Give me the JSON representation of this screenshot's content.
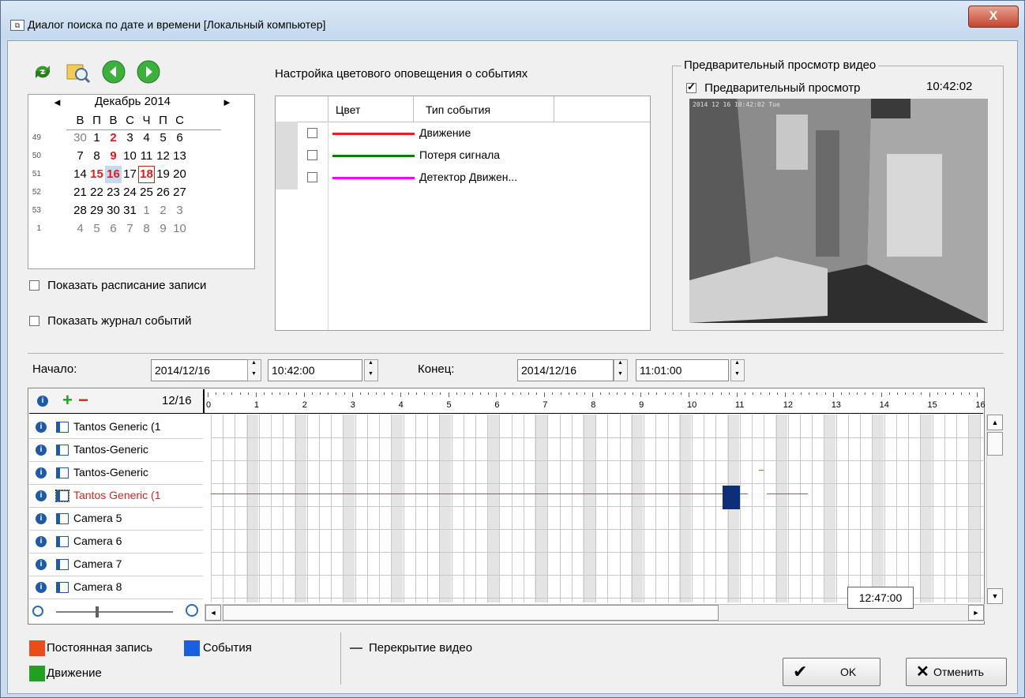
{
  "window": {
    "title": "Диалог поиска по дате и времени [Локальный компьютер]",
    "close_label": "X"
  },
  "toolbar": {
    "icons": [
      "refresh-icon",
      "search-folder-icon",
      "prev-arrow-icon",
      "next-arrow-icon"
    ]
  },
  "calendar": {
    "month_label": "Декабрь 2014",
    "prev_label": "◄",
    "next_label": "►",
    "weekdays": [
      "В",
      "П",
      "В",
      "С",
      "Ч",
      "П",
      "С"
    ],
    "weeks": [
      {
        "num": "49",
        "days": [
          "30",
          "1",
          "2",
          "3",
          "4",
          "5",
          "6"
        ]
      },
      {
        "num": "50",
        "days": [
          "7",
          "8",
          "9",
          "10",
          "11",
          "12",
          "13"
        ]
      },
      {
        "num": "51",
        "days": [
          "14",
          "15",
          "16",
          "17",
          "18",
          "19",
          "20"
        ]
      },
      {
        "num": "52",
        "days": [
          "21",
          "22",
          "23",
          "24",
          "25",
          "26",
          "27"
        ]
      },
      {
        "num": "53",
        "days": [
          "28",
          "29",
          "30",
          "31",
          "1",
          "2",
          "3"
        ]
      },
      {
        "num": "1",
        "days": [
          "4",
          "5",
          "6",
          "7",
          "8",
          "9",
          "10"
        ]
      }
    ],
    "bold_red_days": [
      "2",
      "9",
      "15",
      "16",
      "18"
    ],
    "selected_day": "16",
    "today_day": "18"
  },
  "options": {
    "show_schedule": "Показать расписание записи",
    "show_log": "Показать журнал событий"
  },
  "color_events": {
    "heading": "Настройка цветового оповещения о событиях",
    "col_color": "Цвет",
    "col_type": "Тип события",
    "rows": [
      {
        "color": "#ee1c1c",
        "type": "Движение"
      },
      {
        "color": "#107c10",
        "type": "Потеря сигнала"
      },
      {
        "color": "#ff00ff",
        "type": "Детектор Движен..."
      }
    ]
  },
  "preview": {
    "group_label": "Предварительный просмотр видео",
    "checkbox_label": "Предварительный просмотр",
    "time": "10:42:02"
  },
  "range": {
    "start_label": "Начало:",
    "start_date": "2014/12/16",
    "start_time": "10:42:00",
    "end_label": "Конец:",
    "end_date": "2014/12/16",
    "end_time": "11:01:00"
  },
  "timeline": {
    "date_label": "12/16",
    "hours": [
      "0",
      "1",
      "2",
      "3",
      "4",
      "5",
      "6",
      "7",
      "8",
      "9",
      "10",
      "11",
      "12",
      "13",
      "14",
      "15",
      "16"
    ],
    "cameras": [
      {
        "name": "Tantos Generic (1",
        "active": false
      },
      {
        "name": "Tantos-Generic",
        "active": false
      },
      {
        "name": "Tantos-Generic",
        "active": false
      },
      {
        "name": "Tantos Generic (1",
        "active": true
      },
      {
        "name": "Camera 5",
        "active": false
      },
      {
        "name": "Camera 6",
        "active": false
      },
      {
        "name": "Camera 7",
        "active": false
      },
      {
        "name": "Camera 8",
        "active": false
      }
    ],
    "tooltip_time": "12:47:00"
  },
  "legend": {
    "continuous": "Постоянная запись",
    "events": "События",
    "motion": "Движение",
    "overlap": "Перекрытие видео",
    "colors": {
      "continuous": "#ee4b1c",
      "events": "#1a5fe0",
      "motion": "#22a022"
    }
  },
  "buttons": {
    "ok": "OK",
    "cancel": "Отменить"
  }
}
